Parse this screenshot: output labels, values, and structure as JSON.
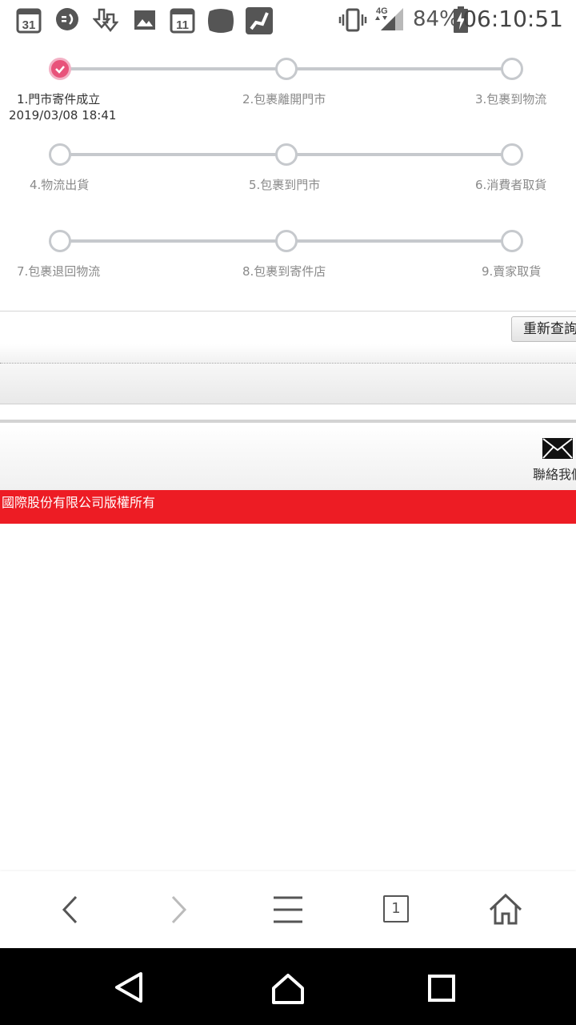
{
  "status_bar": {
    "notifications": [
      "calendar-31-icon",
      "messenger-icon",
      "download-icon",
      "image-icon",
      "calendar-11-icon",
      "app-icon",
      "shop-icon"
    ],
    "calendar_day_a": "31",
    "calendar_day_b": "11",
    "network": "4G",
    "battery": "84%",
    "time": "06:10:51"
  },
  "tracker": {
    "steps": [
      {
        "label": "1.門市寄件成立",
        "date": "2019/03/08 18:41",
        "done": true
      },
      {
        "label": "2.包裹離開門市",
        "done": false
      },
      {
        "label": "3.包裹到物流",
        "done": false
      },
      {
        "label": "4.物流出貨",
        "done": false
      },
      {
        "label": "5.包裹到門市",
        "done": false
      },
      {
        "label": "6.消費者取貨",
        "done": false
      },
      {
        "label": "7.包裹退回物流",
        "done": false
      },
      {
        "label": "8.包裹到寄件店",
        "done": false
      },
      {
        "label": "9.賣家取貨",
        "done": false
      }
    ]
  },
  "actions": {
    "requery_label": "重新查詢"
  },
  "footer": {
    "contact_label": "聯絡我們",
    "copyright": "國際股份有限公司版權所有"
  },
  "browser_bar": {
    "tab_count": "1",
    "buttons": [
      "back-icon",
      "forward-icon",
      "menu-icon",
      "tabs-icon",
      "home-icon"
    ]
  },
  "system_nav": {
    "buttons": [
      "back-triangle-icon",
      "home-circle-icon",
      "recents-square-icon"
    ]
  },
  "colors": {
    "accent": "#e8527a",
    "footer_red": "#ed1c24",
    "track_grey": "#c6c9cd"
  }
}
